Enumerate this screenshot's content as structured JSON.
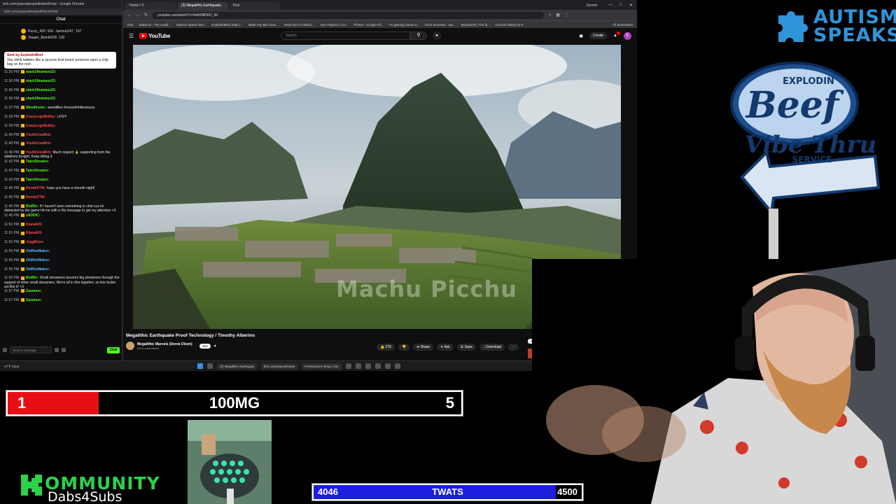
{
  "kick": {
    "window_title": "kick.com/popout/explodinbeef/chat - Google Chrome",
    "url": "kick.com/popout/explodinbeef/chat",
    "chat_header": "Chat",
    "leaderboard": [
      {
        "name": "Pezzy_420",
        "count": "626"
      },
      {
        "name": "Jammin247",
        "count": "167"
      },
      {
        "name": "Yeager_Bombl228",
        "count": "130"
      }
    ],
    "pinned": {
      "by": "Sent by ExplodinBeef",
      "text": "You climb ladders like a raccoon that heard someone open a chip bag on the roof."
    },
    "messages": [
      {
        "time": "11:35 PM",
        "user": "stack2thamaxx23:",
        "text": "",
        "color": "green"
      },
      {
        "time": "11:36 PM",
        "user": "stack2thamaxx23:",
        "text": "",
        "color": "green"
      },
      {
        "time": "11:36 PM",
        "user": "stack2thamaxx23:",
        "text": "",
        "color": "green"
      },
      {
        "time": "11:36 PM",
        "user": "stack2thamaxx23:",
        "text": "",
        "color": "green"
      },
      {
        "time": "11:37 PM",
        "user": "Weedtronic:",
        "text": "weedilllee frreesshhhlleeessss",
        "color": "green"
      },
      {
        "time": "11:39 PM",
        "user": "CrazyLegsBobby:",
        "text": "LFG!!!",
        "color": "red"
      },
      {
        "time": "11:39 PM",
        "user": "CrazyLegsBobby:",
        "text": "",
        "color": "red"
      },
      {
        "time": "11:40 PM",
        "user": "YouthCrewBrit:",
        "text": "",
        "color": "red"
      },
      {
        "time": "11:40 PM",
        "user": "YouthCrewBrit:",
        "text": "",
        "color": "red"
      },
      {
        "time": "11:40 PM",
        "user": "YouthCrewBrit:",
        "text": "Much respect 🙏 supporting from the sidelines tonight. Keep killing it.",
        "color": "red"
      },
      {
        "time": "11:42 PM",
        "user": "TaterStreamz:",
        "text": "",
        "color": "green"
      },
      {
        "time": "11:42 PM",
        "user": "TaterStreamz:",
        "text": "",
        "color": "green"
      },
      {
        "time": "11:43 PM",
        "user": "TaterStreamz:",
        "text": "",
        "color": "green"
      },
      {
        "time": "11:45 PM",
        "user": "HoodsFTW:",
        "text": "hope you have a smooth night!",
        "color": "red"
      },
      {
        "time": "11:45 PM",
        "user": "HoodsFTW:",
        "text": "",
        "color": "red"
      },
      {
        "time": "11:45 PM",
        "user": "BotRix:",
        "text": "If I haven't seen something in chat cuz im distracted by the game hit me with a !tts message to get my attention <3",
        "color": "green"
      },
      {
        "time": "11:45 PM",
        "user": "xADDIC:",
        "text": "",
        "color": "green"
      },
      {
        "time": "11:51 PM",
        "user": "Klana420:",
        "text": "",
        "color": "red"
      },
      {
        "time": "11:51 PM",
        "user": "Klana420:",
        "text": "",
        "color": "red"
      },
      {
        "time": "11:52 PM",
        "user": "JuggBoxx:",
        "text": "",
        "color": "red"
      },
      {
        "time": "11:55 PM",
        "user": "OldRiotMaker:",
        "text": "",
        "color": "blue"
      },
      {
        "time": "11:55 PM",
        "user": "OldRiotMaker:",
        "text": "",
        "color": "blue"
      },
      {
        "time": "11:55 PM",
        "user": "OldRiotMaker:",
        "text": "",
        "color": "blue"
      },
      {
        "time": "11:56 PM",
        "user": "BotRix:",
        "text": "Small streamers become big streamers through the support of other small streamers. We're all in this together, so lets fuckin act like it! <3",
        "color": "green"
      },
      {
        "time": "11:57 PM",
        "user": "Zaramux:",
        "text": "",
        "color": "green"
      },
      {
        "time": "11:57 PM",
        "user": "Zaramux:",
        "text": "",
        "color": "green"
      }
    ],
    "input_placeholder": "Send a message",
    "send_label": "Chat"
  },
  "browser": {
    "tabs": [
      "Home / X",
      "(3) Megalithic Earthquake",
      "Kick"
    ],
    "gemini_label": "Gemini",
    "url": "youtube.com/watch?v=4aNXBDKD_5d",
    "bookmarks": [
      "Kick",
      "Stake.us - The Leadi...",
      "Internet Speed Test...",
      "ExplodinBeef Stats |...",
      "Make Any Mix Soun...",
      "Welcome to Oklaho...",
      "Your Pepsico | civi...",
      "Photos - Google Ph...",
      "Fe gaming issues a...",
      "KICK Bounties - ww...",
      "Myinstants | The la...",
      "Liminal Gallery by k..."
    ],
    "all_bookmarks": "All Bookmarks"
  },
  "youtube": {
    "logo_text": "YouTube",
    "search_placeholder": "Search",
    "create_label": "Create",
    "avatar_letter": "E",
    "watermark": "Machu Picchu",
    "video_title": "Megalithic Earthquake Proof Technology / Timothy Alberino",
    "channel_name": "Megalithic Marvels (Derek Olson)",
    "channel_subs": "531K subscribers",
    "join_label": "Join",
    "likes": "276",
    "share_label": "Share",
    "ask_label": "Ask",
    "save_label": "Save",
    "download_label": "Download",
    "chips": [
      "All",
      "Historic sites",
      "Watched"
    ],
    "ad_title": "Get Legendary Ezlo for free",
    "ad_sub": "Download RAID to add Ezlo Ankhira"
  },
  "taskbar": {
    "weather": "47°F Clear",
    "items": [
      "(3) Megalithic Earthquak",
      "kick.com/popout/explo",
      "Performance Shop | Nor"
    ],
    "time": "11:57 PM",
    "date": "2/6/2026"
  },
  "overlay": {
    "autism_line1": "AUTISM",
    "autism_line2": "SPEAKS",
    "beef_top": "EXPLODIN",
    "beef_main": "Beef",
    "vibe": "Vibe Thru",
    "service": "SERVICE",
    "kommunity_word": "OMMUNITY",
    "kommunity_sub": "Dabs4Subs"
  },
  "goal1": {
    "left": "1",
    "label": "100MG",
    "right": "5",
    "progress": 0.2,
    "color": "#e80f14"
  },
  "goal2": {
    "left": "4046",
    "label": "TWATS",
    "right": "4500",
    "progress": 0.899,
    "color": "#1d1de0"
  }
}
